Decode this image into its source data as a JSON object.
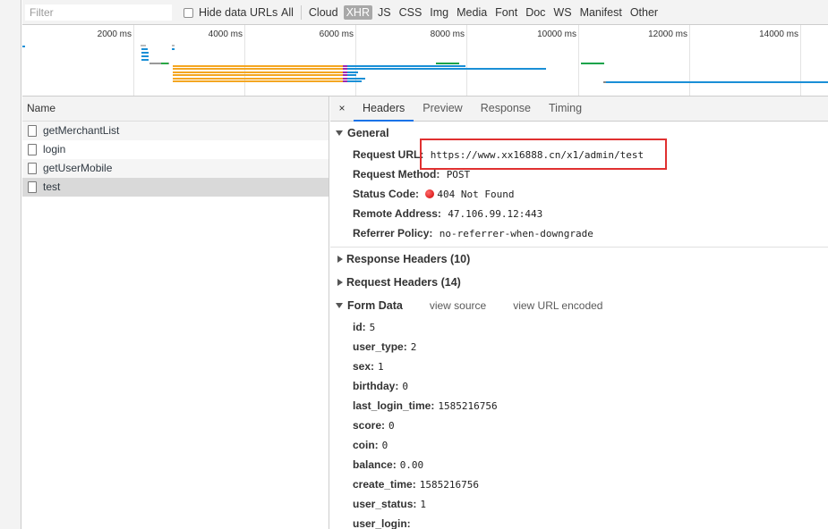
{
  "toolbar": {
    "filter_placeholder": "Filter",
    "hide_data_urls": "Hide data URLs",
    "types": [
      "All",
      "Cloud",
      "XHR",
      "JS",
      "CSS",
      "Img",
      "Media",
      "Font",
      "Doc",
      "WS",
      "Manifest",
      "Other"
    ],
    "active_type": "XHR"
  },
  "overview": {
    "ticks": [
      "2000 ms",
      "4000 ms",
      "6000 ms",
      "8000 ms",
      "10000 ms",
      "12000 ms",
      "14000 ms"
    ]
  },
  "requests": {
    "header": "Name",
    "items": [
      "getMerchantList",
      "login",
      "getUserMobile",
      "test"
    ],
    "selected": "test"
  },
  "details": {
    "close": "×",
    "tabs": [
      "Headers",
      "Preview",
      "Response",
      "Timing"
    ],
    "active_tab": "Headers",
    "general": {
      "title": "General",
      "request_url_label": "Request URL:",
      "request_url": "https://www.xx16888.cn/x1/admin/test",
      "request_method_label": "Request Method:",
      "request_method": "POST",
      "status_code_label": "Status Code:",
      "status_code": "404 Not Found",
      "remote_address_label": "Remote Address:",
      "remote_address": "47.106.99.12:443",
      "referrer_policy_label": "Referrer Policy:",
      "referrer_policy": "no-referrer-when-downgrade"
    },
    "response_headers": "Response Headers (10)",
    "request_headers": "Request Headers (14)",
    "form_data": {
      "title": "Form Data",
      "view_source": "view source",
      "view_url_encoded": "view URL encoded",
      "fields": [
        {
          "key": "id:",
          "value": "5"
        },
        {
          "key": "user_type:",
          "value": "2"
        },
        {
          "key": "sex:",
          "value": "1"
        },
        {
          "key": "birthday:",
          "value": "0"
        },
        {
          "key": "last_login_time:",
          "value": "1585216756"
        },
        {
          "key": "score:",
          "value": "0"
        },
        {
          "key": "coin:",
          "value": "0"
        },
        {
          "key": "balance:",
          "value": "0.00"
        },
        {
          "key": "create_time:",
          "value": "1585216756"
        },
        {
          "key": "user_status:",
          "value": "1"
        },
        {
          "key": "user_login:",
          "value": ""
        }
      ]
    }
  }
}
